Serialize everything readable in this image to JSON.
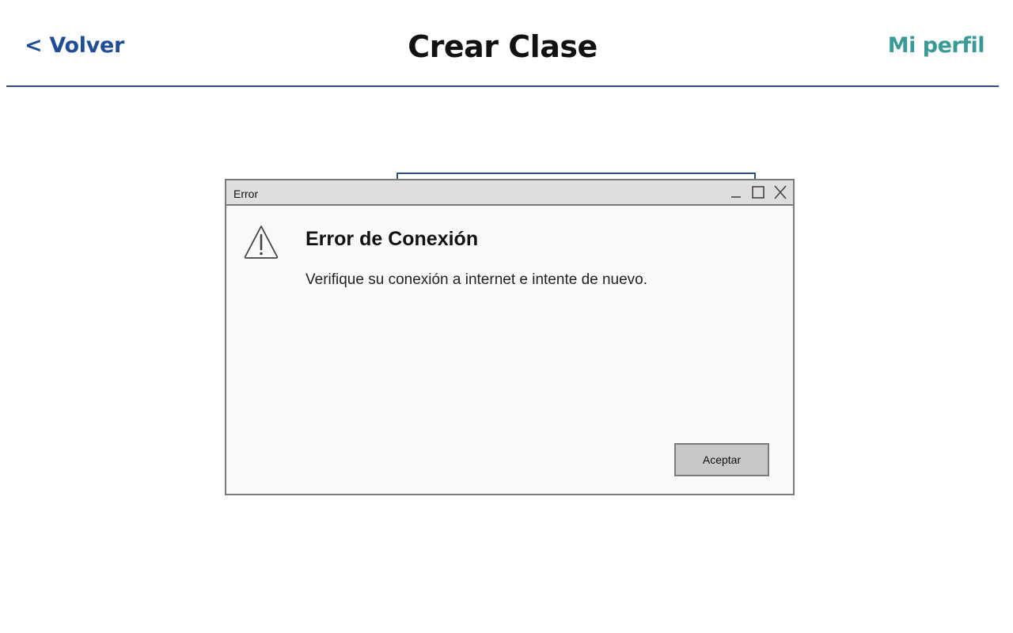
{
  "header": {
    "back_label": "< Volver",
    "title": "Crear Clase",
    "profile_label": "Mi perfil"
  },
  "dialog": {
    "window_title": "Error",
    "heading": "Error de Conexión",
    "message": "Verifique su conexión a internet e intente de nuevo.",
    "ok_label": "Aceptar",
    "icon": "warning-icon",
    "window_controls": [
      "minimize-icon",
      "maximize-icon",
      "close-icon"
    ]
  },
  "colors": {
    "back_link": "#1f4e96",
    "profile_link": "#3a9a96",
    "header_rule": "#2f4f87",
    "dialog_titlebar": "#dedede",
    "dialog_body": "#f9f9f9",
    "button_bg": "#c8c8c8"
  }
}
